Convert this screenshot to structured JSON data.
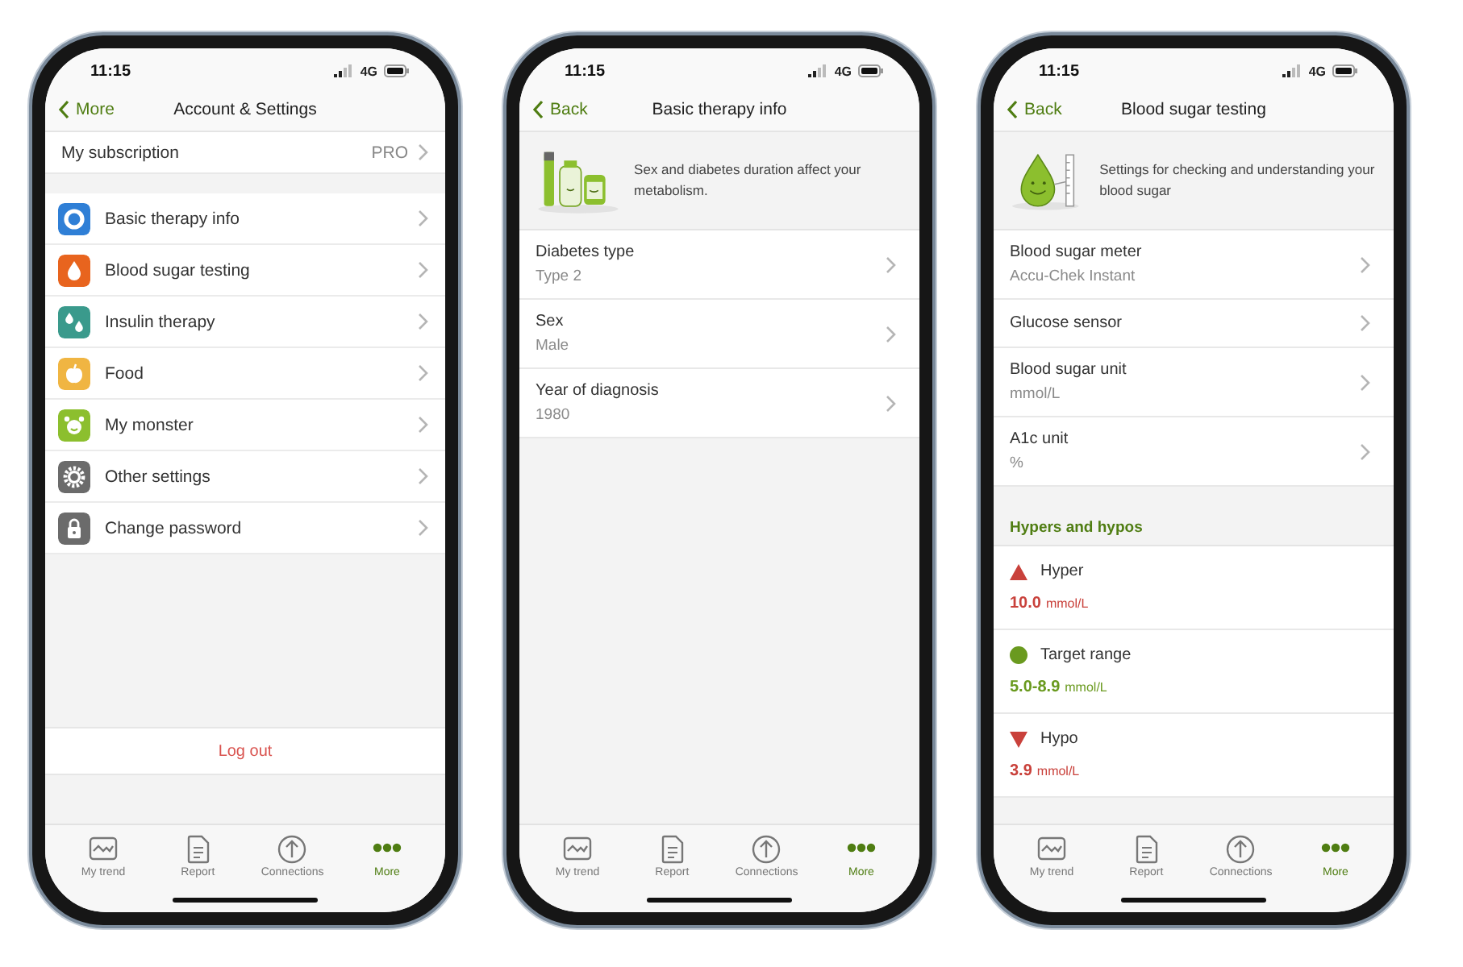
{
  "phones": [
    {
      "status": {
        "time": "11:15",
        "network": "4G"
      },
      "nav": {
        "back": "More",
        "title": "Account & Settings"
      },
      "kind": "menu",
      "subscription": {
        "label": "My subscription",
        "value": "PRO"
      },
      "menu_items": [
        {
          "label": "Basic therapy info",
          "color": "#2f7fd6"
        },
        {
          "label": "Blood sugar testing",
          "color": "#e8641e"
        },
        {
          "label": "Insulin therapy",
          "color": "#3a9a8c"
        },
        {
          "label": "Food",
          "color": "#f0b542"
        },
        {
          "label": "My monster",
          "color": "#8cbf2e"
        },
        {
          "label": "Other settings",
          "color": "#6b6b6b"
        },
        {
          "label": "Change password",
          "color": "#6b6b6b"
        }
      ],
      "log_out": "Log out",
      "tabs": [
        {
          "label": "My trend",
          "selected": false
        },
        {
          "label": "Report",
          "selected": false
        },
        {
          "label": "Connections",
          "selected": false
        },
        {
          "label": "More",
          "selected": true
        }
      ]
    },
    {
      "status": {
        "time": "11:15",
        "network": "4G"
      },
      "nav": {
        "back": "Back",
        "title": "Basic therapy info"
      },
      "kind": "details",
      "banner": {
        "kind": "therapy",
        "text": "Sex and diabetes duration affect your metabolism."
      },
      "rows": [
        {
          "label": "Diabetes type",
          "value": "Type 2"
        },
        {
          "label": "Sex",
          "value": "Male"
        },
        {
          "label": "Year of diagnosis",
          "value": "1980"
        }
      ],
      "tabs": [
        {
          "label": "My trend",
          "selected": false
        },
        {
          "label": "Report",
          "selected": false
        },
        {
          "label": "Connections",
          "selected": false
        },
        {
          "label": "More",
          "selected": true
        }
      ]
    },
    {
      "status": {
        "time": "11:15",
        "network": "4G"
      },
      "nav": {
        "back": "Back",
        "title": "Blood sugar testing"
      },
      "kind": "details",
      "banner": {
        "kind": "drop",
        "text": "Settings for checking and understanding your blood sugar"
      },
      "rows": [
        {
          "label": "Blood sugar meter",
          "value": "Accu-Chek Instant"
        },
        {
          "label": "Glucose sensor"
        },
        {
          "label": "Blood sugar unit",
          "value": "mmol/L"
        },
        {
          "label": "A1c unit",
          "value": "%"
        }
      ],
      "section_title": "Hypers and hypos",
      "thresholds": [
        {
          "kind": "hyper",
          "label": "Hyper",
          "value": "10.0",
          "unit": "mmol/L",
          "color": "#c9413b"
        },
        {
          "kind": "target",
          "label": "Target range",
          "value": "5.0-8.9",
          "unit": "mmol/L",
          "color": "#6a9a1f"
        },
        {
          "kind": "hypo",
          "label": "Hypo",
          "value": "3.9",
          "unit": "mmol/L",
          "color": "#c9413b"
        }
      ],
      "tabs": [
        {
          "label": "My trend",
          "selected": false
        },
        {
          "label": "Report",
          "selected": false
        },
        {
          "label": "Connections",
          "selected": false
        },
        {
          "label": "More",
          "selected": true
        }
      ]
    }
  ]
}
